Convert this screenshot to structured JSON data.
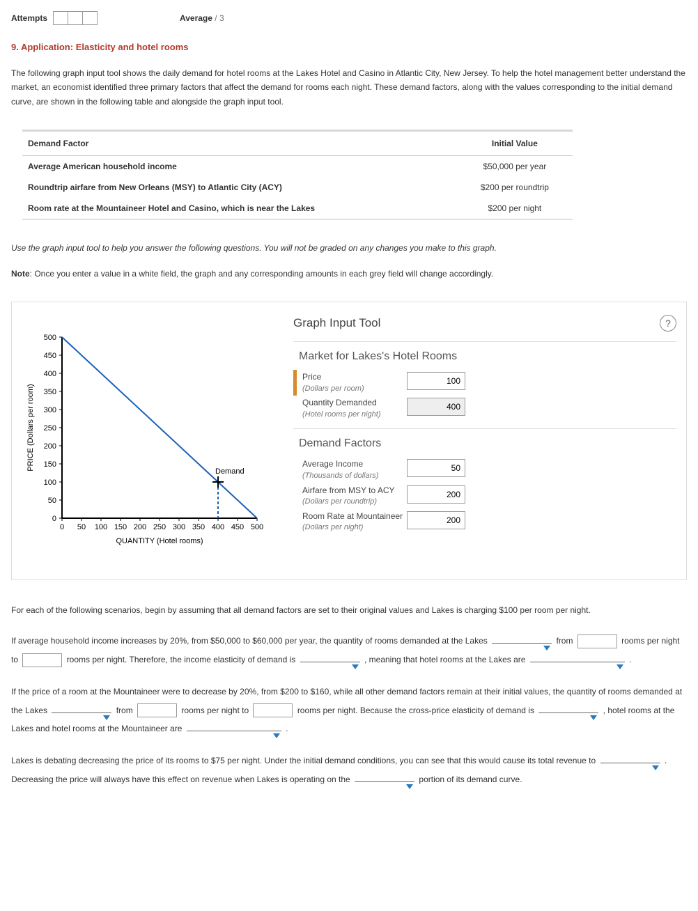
{
  "attempts_label": "Attempts",
  "average_label": "Average",
  "average_denom": "/ 3",
  "title": "9. Application: Elasticity and hotel rooms",
  "intro": "The following graph input tool shows the daily demand for hotel rooms at the Lakes Hotel and Casino in Atlantic City, New Jersey. To help the hotel management better understand the market, an economist identified three primary factors that affect the demand for rooms each night. These demand factors, along with the values corresponding to the initial demand curve, are shown in the following table and alongside the graph input tool.",
  "table": {
    "h1": "Demand Factor",
    "h2": "Initial Value",
    "rows": [
      {
        "f": "Average American household income",
        "v": "$50,000 per year"
      },
      {
        "f": "Roundtrip airfare from New Orleans (MSY) to Atlantic City (ACY)",
        "v": "$200 per roundtrip"
      },
      {
        "f": "Room rate at the Mountaineer Hotel and Casino, which is near the Lakes",
        "v": "$200 per night"
      }
    ]
  },
  "instr_italic": "Use the graph input tool to help you answer the following questions. You will not be graded on any changes you make to this graph.",
  "note_b": "Note",
  "note": ": Once you enter a value in a white field, the graph and any corresponding amounts in each grey field will change accordingly.",
  "tool": {
    "title": "Graph Input Tool",
    "market": "Market for Lakes's Hotel Rooms",
    "price_l": "Price",
    "price_s": "(Dollars per room)",
    "price_v": "100",
    "qty_l": "Quantity Demanded",
    "qty_s": "(Hotel rooms per night)",
    "qty_v": "400",
    "df_title": "Demand Factors",
    "inc_l": "Average Income",
    "inc_s": "(Thousands of dollars)",
    "inc_v": "50",
    "air_l": "Airfare from MSY to ACY",
    "air_s": "(Dollars per roundtrip)",
    "air_v": "200",
    "mtn_l": "Room Rate at Mountaineer",
    "mtn_s": "(Dollars per night)",
    "mtn_v": "200"
  },
  "chart_data": {
    "type": "line",
    "title": "",
    "xlabel": "QUANTITY (Hotel rooms)",
    "ylabel": "PRICE (Dollars per room)",
    "xlim": [
      0,
      500
    ],
    "ylim": [
      0,
      500
    ],
    "xticks": [
      0,
      50,
      100,
      150,
      200,
      250,
      300,
      350,
      400,
      450,
      500
    ],
    "yticks": [
      0,
      50,
      100,
      150,
      200,
      250,
      300,
      350,
      400,
      450,
      500
    ],
    "series": [
      {
        "name": "Demand",
        "x": [
          0,
          500
        ],
        "y": [
          500,
          0
        ]
      }
    ],
    "marker": {
      "x": 400,
      "y": 100
    }
  },
  "q_intro": "For each of the following scenarios, begin by assuming that all demand factors are set to their original values and Lakes is charging $100 per room per night.",
  "q1": {
    "a": "If average household income increases by 20%, from $50,000 to $60,000 per year, the quantity of rooms demanded at the Lakes ",
    "b": " from ",
    "c": " rooms per night to ",
    "d": " rooms per night. Therefore, the income elasticity of demand is ",
    "e": " , meaning that hotel rooms at the Lakes are ",
    "f": " ."
  },
  "q2": {
    "a": "If the price of a room at the Mountaineer were to decrease by 20%, from $200 to $160, while all other demand factors remain at their initial values, the quantity of rooms demanded at the Lakes ",
    "b": " from ",
    "c": " rooms per night to ",
    "d": " rooms per night. Because the cross-price elasticity of demand is ",
    "e": " , hotel rooms at the Lakes and hotel rooms at the Mountaineer are ",
    "f": " ."
  },
  "q3": {
    "a": "Lakes is debating decreasing the price of its rooms to $75 per night. Under the initial demand conditions, you can see that this would cause its total revenue to ",
    "b": " . Decreasing the price will always have this effect on revenue when Lakes is operating on the ",
    "c": " portion of its demand curve."
  }
}
